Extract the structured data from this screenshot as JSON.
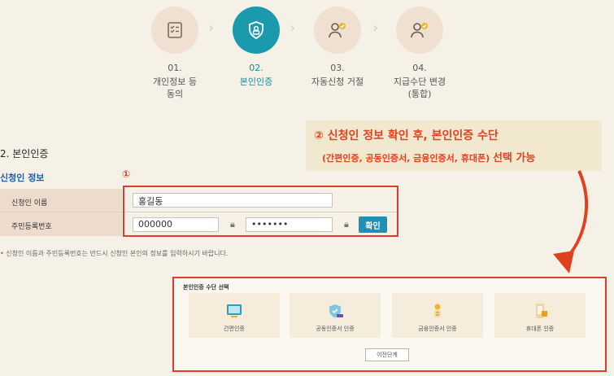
{
  "steps": [
    {
      "num": "01.",
      "label": "개인정보 등\n동의",
      "icon": "checklist-icon",
      "active": false
    },
    {
      "num": "02.",
      "label": "본인인증",
      "icon": "shield-user-icon",
      "active": true
    },
    {
      "num": "03.",
      "label": "자동신청 거절",
      "icon": "user-check-icon",
      "active": false
    },
    {
      "num": "04.",
      "label": "지급수단 변경\n(통합)",
      "icon": "user-check-icon",
      "active": false
    }
  ],
  "section": {
    "title": "2. 본인인증",
    "subtitle": "신청인 정보"
  },
  "callout": {
    "line1": "② 신청인 정보 확인 후, 본인인증 수단",
    "line2": "(간편인증, 공동인증서, 금융인증서, 휴대폰)",
    "line2_bold": "선택 가능"
  },
  "markers": {
    "one": "①"
  },
  "form": {
    "name_label": "신청인 이름",
    "name_value": "홍길동",
    "rrn_label": "주민등록번호",
    "rrn_front": "000000",
    "rrn_back": "•••••••",
    "confirm_label": "확인"
  },
  "notice": "신청인 이름과 주민등록번호는 반드시 신청인 본인의 정보를 입력하시기 바랍니다.",
  "auth_panel": {
    "title": "본인인증 수단 선택",
    "methods": [
      {
        "label": "간편인증",
        "icon": "simple-auth-icon"
      },
      {
        "label": "공동인증서 인증",
        "icon": "joint-certificate-icon"
      },
      {
        "label": "금융인증서 인증",
        "icon": "financial-certificate-icon"
      },
      {
        "label": "휴대폰 인증",
        "icon": "mobile-phone-icon"
      }
    ],
    "prev_button": "이전단계"
  },
  "colors": {
    "accent": "#1b9aad",
    "highlight": "#e0421f",
    "background": "#f6f1e7"
  }
}
